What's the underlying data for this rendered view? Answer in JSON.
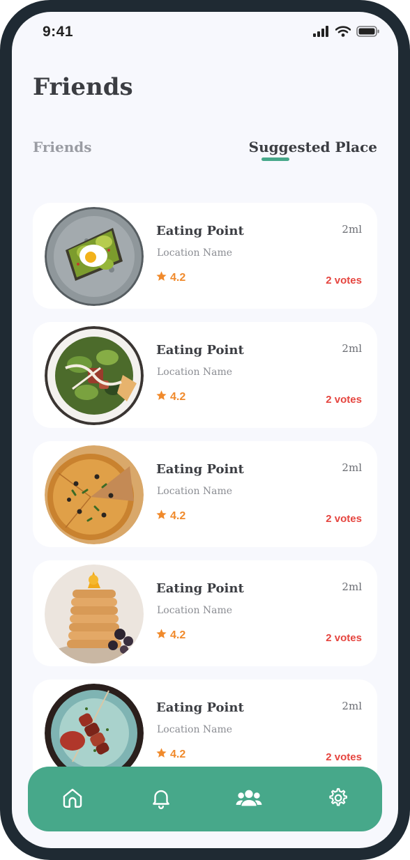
{
  "status_bar": {
    "time": "9:41"
  },
  "header": {
    "title": "Friends"
  },
  "tabs": [
    {
      "label": "Friends",
      "active": false
    },
    {
      "label": "Suggested Place",
      "active": true
    }
  ],
  "places": [
    {
      "name": "Eating Point",
      "location": "Location Name",
      "rating": "4.2",
      "distance": "2ml",
      "votes": "2 votes",
      "image": "avocado-toast"
    },
    {
      "name": "Eating Point",
      "location": "Location Name",
      "rating": "4.2",
      "distance": "2ml",
      "votes": "2 votes",
      "image": "salad"
    },
    {
      "name": "Eating Point",
      "location": "Location Name",
      "rating": "4.2",
      "distance": "2ml",
      "votes": "2 votes",
      "image": "pizza"
    },
    {
      "name": "Eating Point",
      "location": "Location Name",
      "rating": "4.2",
      "distance": "2ml",
      "votes": "2 votes",
      "image": "pancakes"
    },
    {
      "name": "Eating Point",
      "location": "Location Name",
      "rating": "4.2",
      "distance": "2ml",
      "votes": "2 votes",
      "image": "kebab"
    }
  ],
  "bottom_nav": [
    {
      "icon": "home-icon"
    },
    {
      "icon": "bell-icon"
    },
    {
      "icon": "users-icon",
      "active": true
    },
    {
      "icon": "gear-icon"
    }
  ],
  "colors": {
    "accent": "#47a88a",
    "rating": "#f08a2c",
    "votes": "#e5453f",
    "background": "#f7f8fd",
    "frame": "#1f2a33"
  }
}
